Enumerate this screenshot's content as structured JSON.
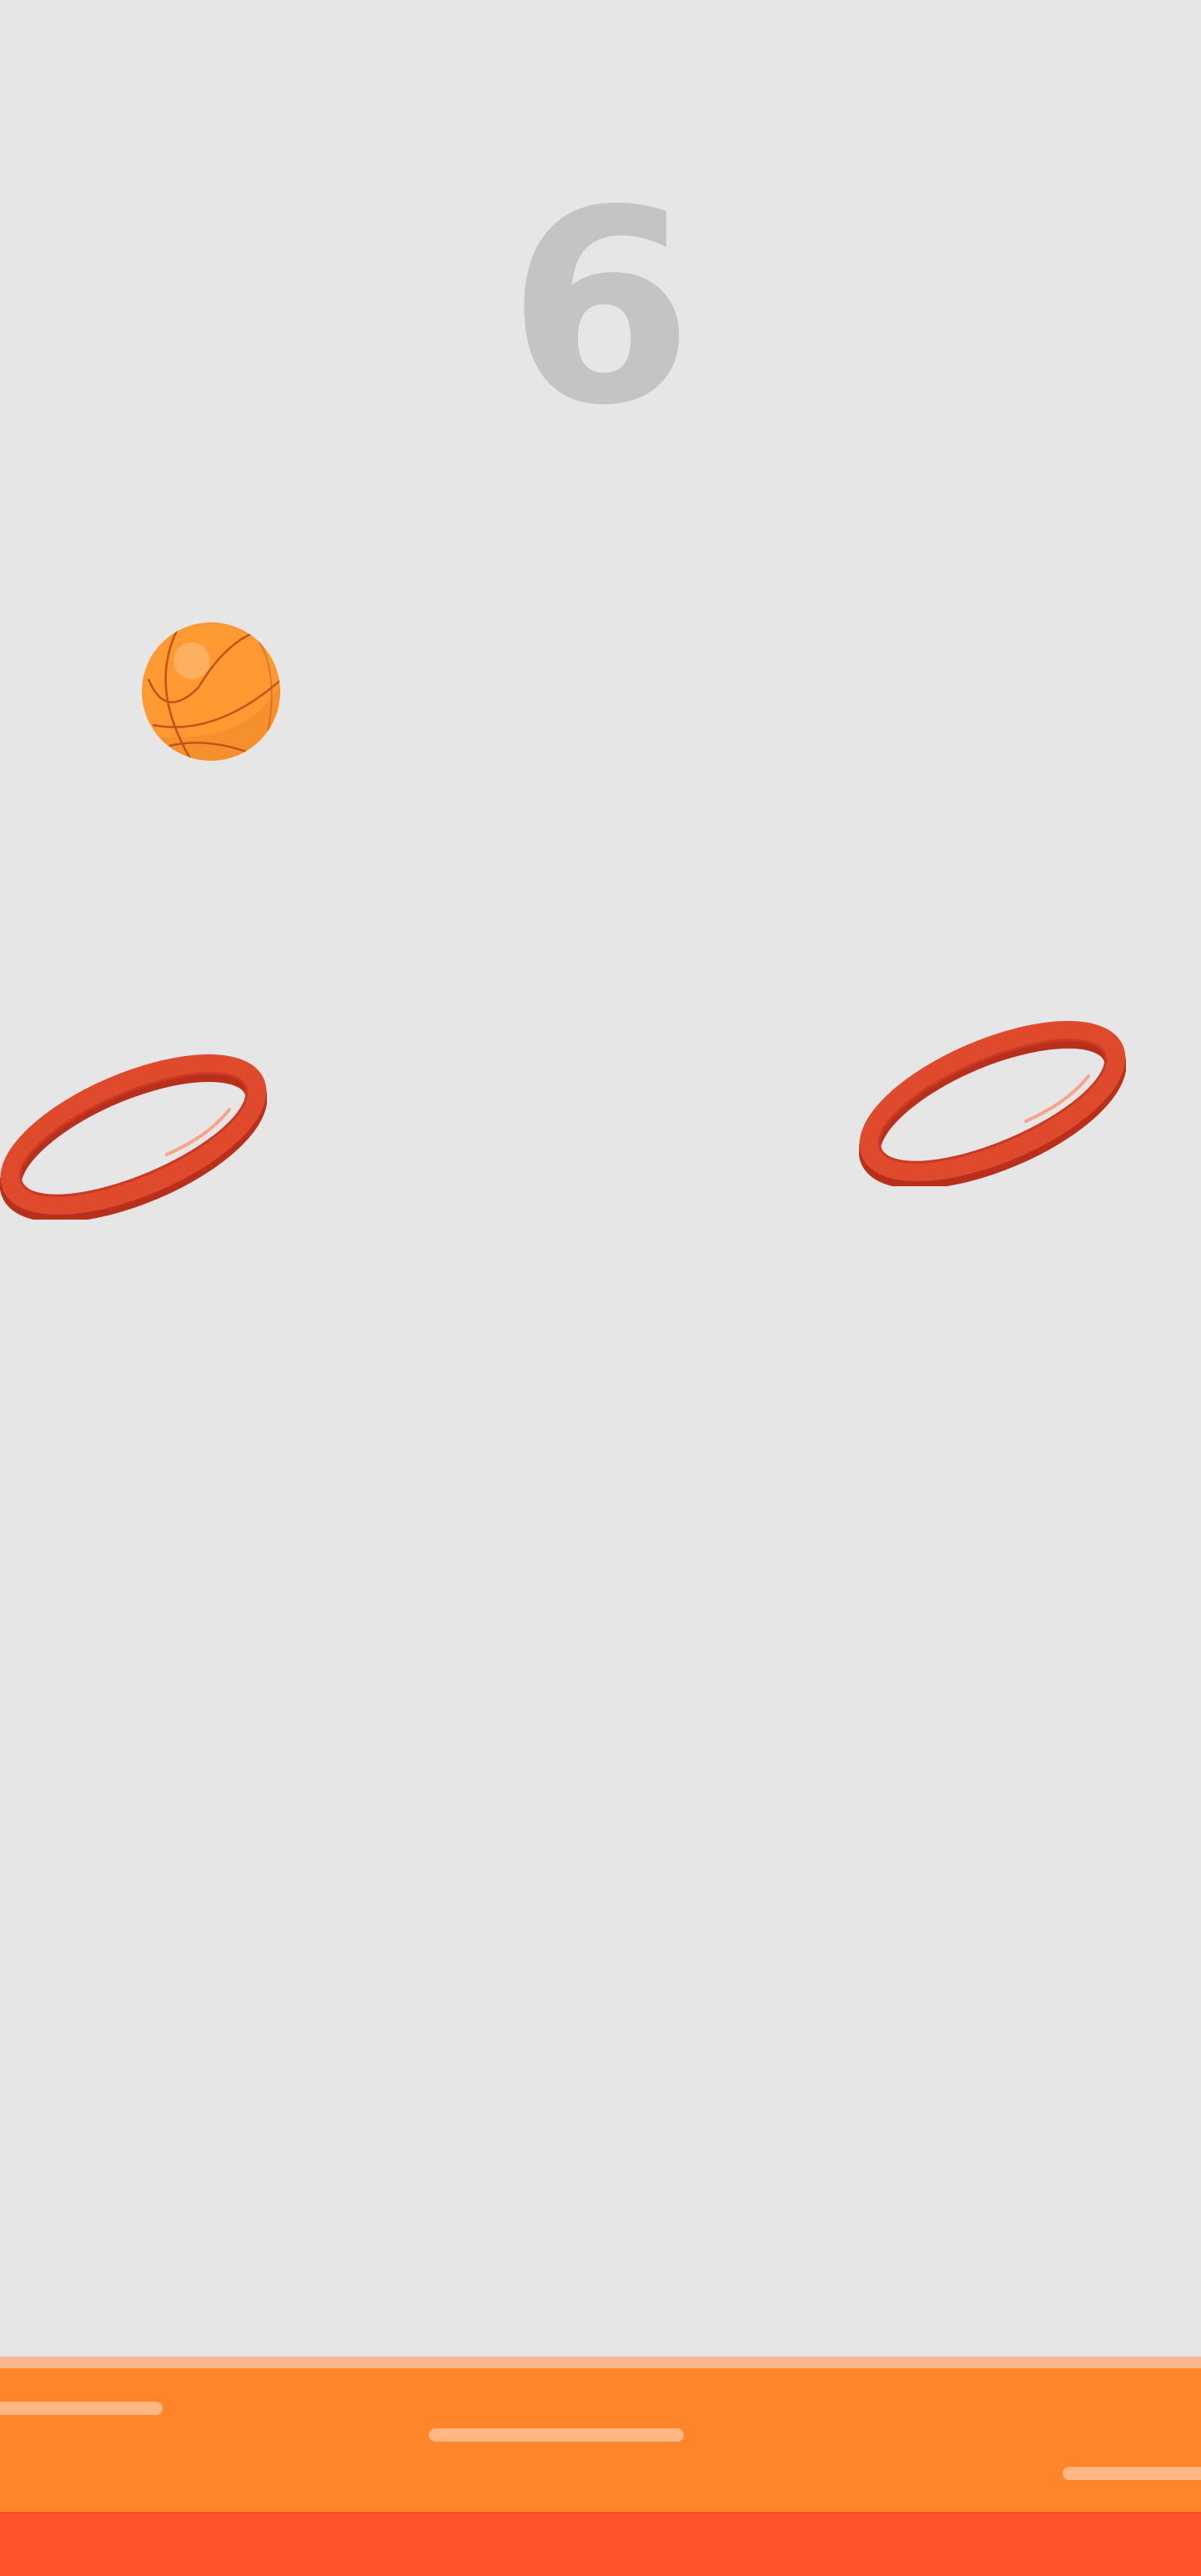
{
  "game": {
    "score": "6"
  },
  "colors": {
    "background": "#e6e6e6",
    "score_text": "#c4c4c4",
    "ball": "#ff9a32",
    "ball_lines": "#c2541a",
    "hoop": "#e04a2c",
    "hoop_shadow": "#b8301c",
    "floor": "#ff852b",
    "floor_edge": "#ff512b"
  },
  "icons": {
    "ball": "basketball-icon",
    "hoop": "hoop-ring-icon"
  }
}
